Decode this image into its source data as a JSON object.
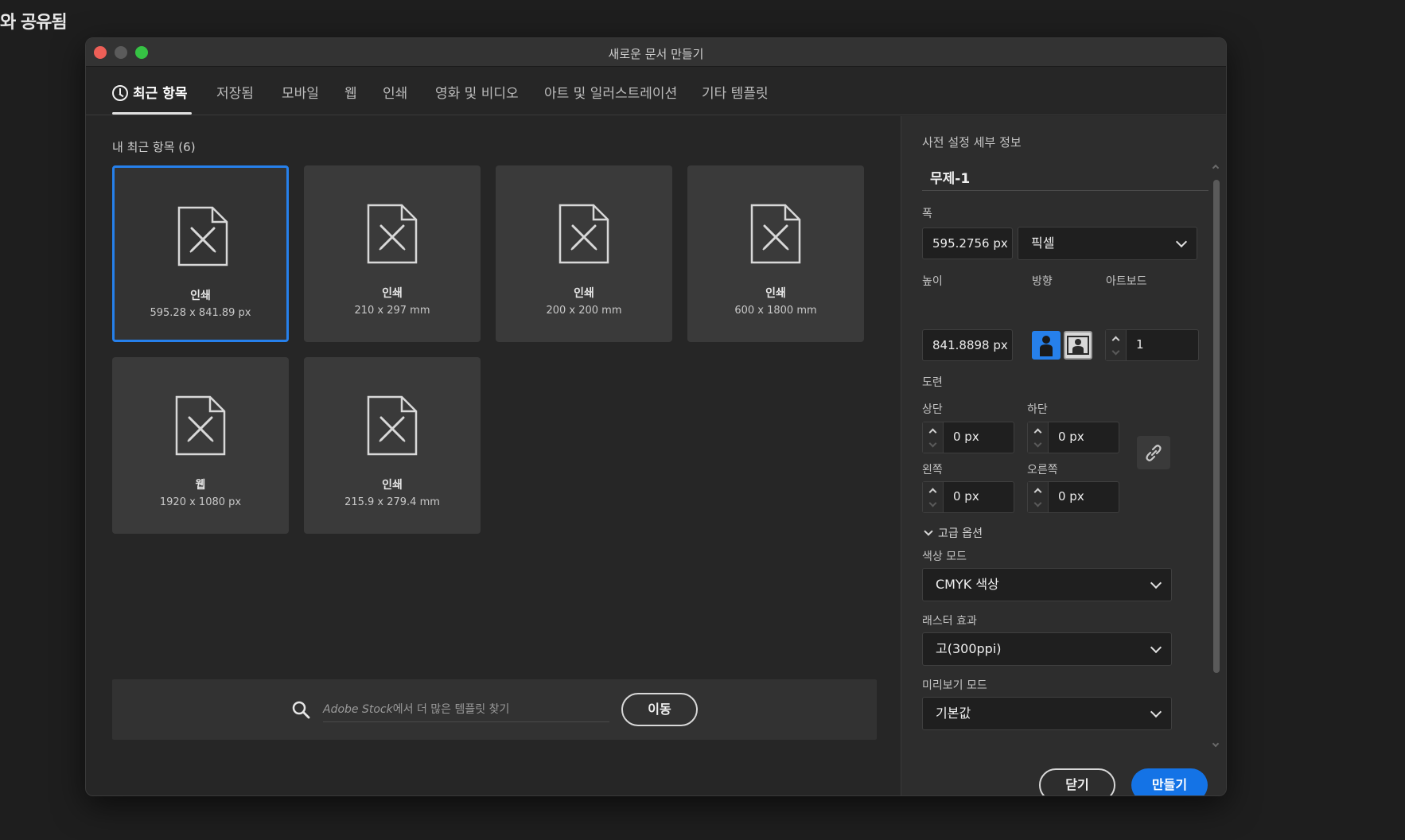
{
  "background": {
    "text": "와 공유됨"
  },
  "dialog": {
    "title": "새로운 문서 만들기"
  },
  "tabs": [
    {
      "label": "최근 항목",
      "active": true
    },
    {
      "label": "저장됨"
    },
    {
      "label": "모바일"
    },
    {
      "label": "웹"
    },
    {
      "label": "인쇄"
    },
    {
      "label": "영화 및 비디오"
    },
    {
      "label": "아트 및 일러스트레이션"
    },
    {
      "label": "기타 템플릿"
    }
  ],
  "recent": {
    "label": "내 최근 항목 (6)",
    "items": [
      {
        "name": "인쇄",
        "size": "595.28 x 841.89 px",
        "selected": true
      },
      {
        "name": "인쇄",
        "size": "210 x 297 mm"
      },
      {
        "name": "인쇄",
        "size": "200 x 200 mm"
      },
      {
        "name": "인쇄",
        "size": "600 x 1800 mm"
      },
      {
        "name": "웹",
        "size": "1920 x 1080 px"
      },
      {
        "name": "인쇄",
        "size": "215.9 x 279.4 mm"
      }
    ]
  },
  "stock": {
    "placeholder_brand": "Adobe Stock",
    "placeholder_rest": "에서 더 많은 템플릿 찾기",
    "go_label": "이동"
  },
  "preset": {
    "heading": "사전 설정 세부 정보",
    "name": "무제-1",
    "width_label": "폭",
    "width_value": "595.2756 px",
    "unit_value": "픽셀",
    "height_label": "높이",
    "height_value": "841.8898 px",
    "orientation_label": "방향",
    "artboard_label": "아트보드",
    "artboard_value": "1",
    "bleed_label": "도련",
    "top_label": "상단",
    "top_value": "0 px",
    "bottom_label": "하단",
    "bottom_value": "0 px",
    "left_label": "왼쪽",
    "left_value": "0 px",
    "right_label": "오른쪽",
    "right_value": "0 px",
    "advanced_label": "고급 옵션",
    "color_mode_label": "색상 모드",
    "color_mode_value": "CMYK 색상",
    "raster_label": "래스터 효과",
    "raster_value": "고(300ppi)",
    "preview_label": "미리보기 모드",
    "preview_value": "기본값"
  },
  "actions": {
    "close_label": "닫기",
    "create_label": "만들기"
  },
  "colors": {
    "accent": "#1473e6",
    "selection": "#2680eb",
    "close": "#ed5f57",
    "maximize": "#36c244"
  },
  "icons": [
    "clock-icon",
    "document-icon",
    "search-icon",
    "link-icon",
    "chevron-down-icon",
    "person-portrait-icon",
    "person-landscape-icon"
  ]
}
